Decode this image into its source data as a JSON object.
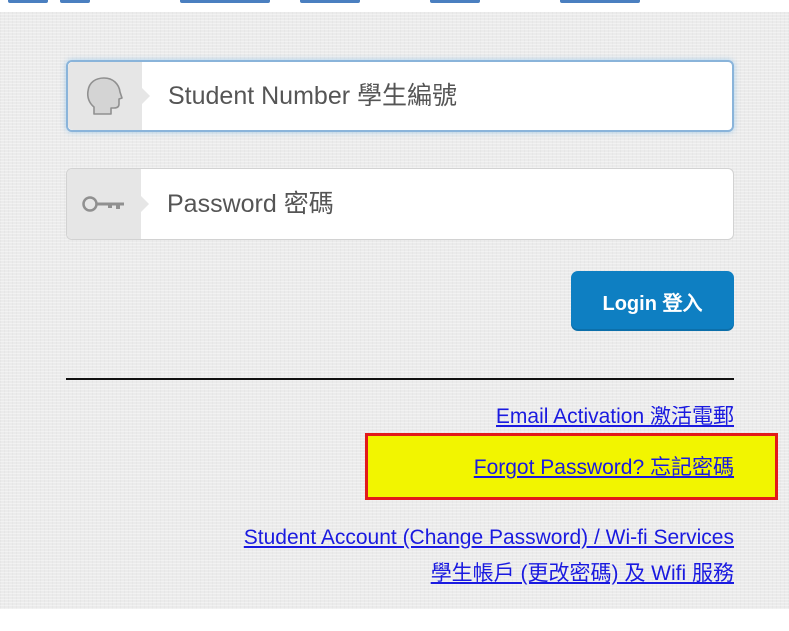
{
  "login_form": {
    "student_number": {
      "placeholder": "Student Number 學生編號",
      "value": ""
    },
    "password": {
      "placeholder": "Password 密碼",
      "value": ""
    },
    "login_label": "Login 登入"
  },
  "links": {
    "email_activation": "Email Activation 激活電郵",
    "forgot_password": "Forgot Password? 忘記密碼",
    "student_account": "Student Account (Change Password) / Wi-fi Services",
    "student_account_zh": "學生帳戶 (更改密碼) 及 Wifi 服務"
  },
  "icons": {
    "student_number": "user-silhouette-icon",
    "password": "key-icon"
  },
  "colors": {
    "accent": "#0e7fc2",
    "link": "#1a1ae0",
    "highlight_fill": "#f2f500",
    "highlight_border": "#e21a1a",
    "focus_border": "#8ab4da"
  }
}
